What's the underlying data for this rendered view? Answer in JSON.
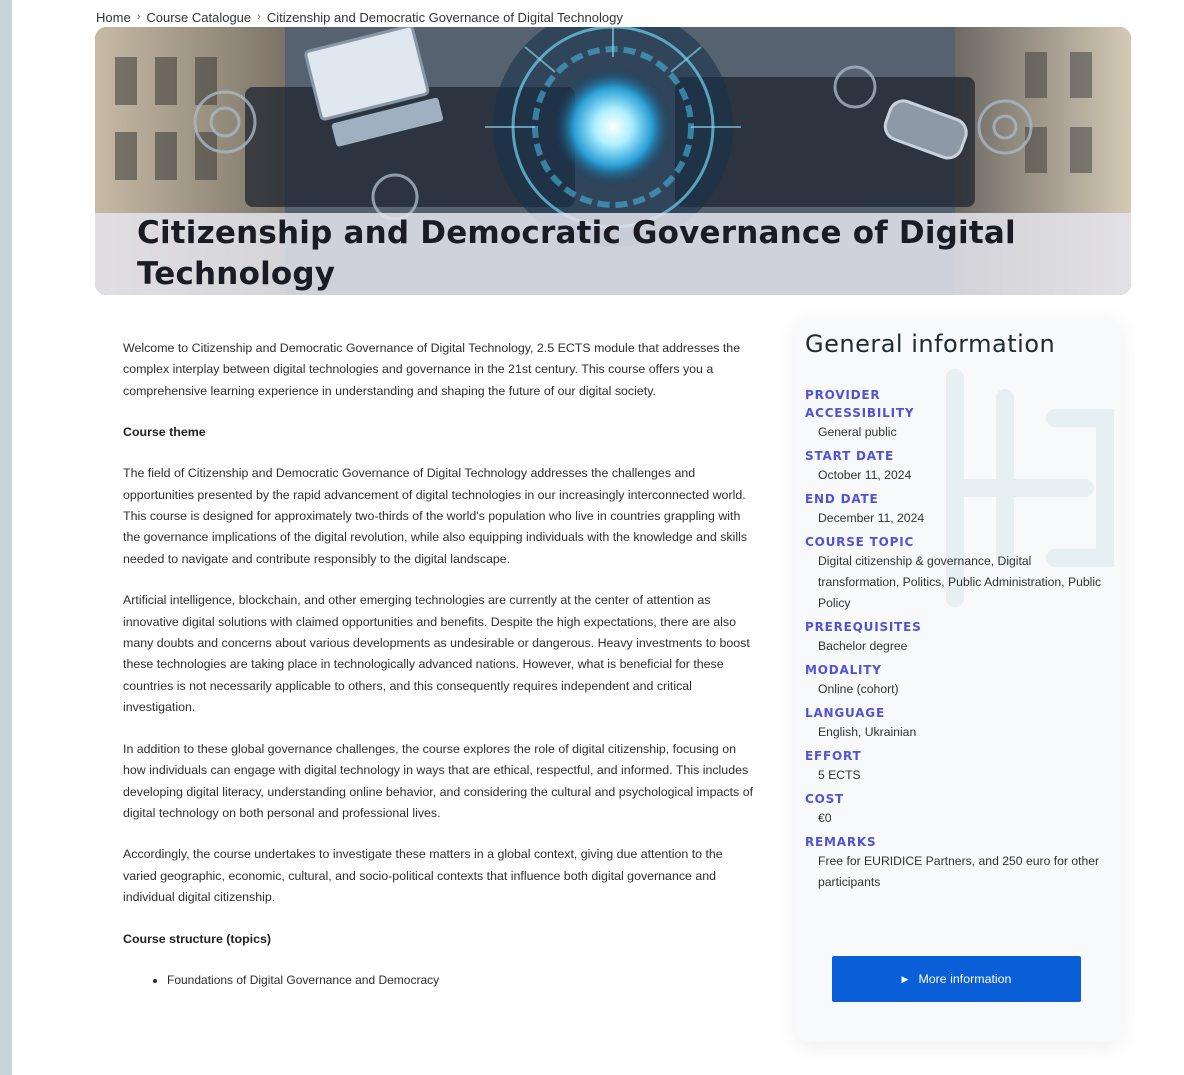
{
  "breadcrumb": {
    "home": "Home",
    "catalogue": "Course Catalogue",
    "current": "Citizenship and Democratic Governance of Digital Technology"
  },
  "hero": {
    "title": "Citizenship and Democratic Governance of Digital Technology"
  },
  "content": {
    "intro": "Welcome to Citizenship and Democratic Governance of Digital Technology, 2.5 ECTS module that addresses the complex interplay between digital technologies and governance in the 21st century. This course offers you a comprehensive learning experience in understanding and shaping the future of our digital society.",
    "theme_heading": "Course theme",
    "theme_p1": "The field of Citizenship and Democratic Governance of Digital Technology addresses the challenges and opportunities presented by the rapid advancement of digital technologies in our increasingly interconnected world. This course is designed for approximately two-thirds of the world's population who live in countries grappling with the governance implications of the digital revolution, while also equipping individuals with the knowledge and skills needed to navigate and contribute responsibly to the digital landscape.",
    "theme_p2": "Artificial intelligence, blockchain, and other emerging technologies are currently at the center of attention as innovative digital solutions with claimed opportunities and benefits. Despite the high expectations, there are also many doubts and concerns about various developments as undesirable or dangerous. Heavy investments to boost these technologies are taking place in technologically advanced nations. However, what is beneficial for these countries is not necessarily applicable to others, and this consequently requires independent and critical investigation.",
    "theme_p3": "In addition to these global governance challenges, the course explores the role of digital citizenship, focusing on how individuals can engage with digital technology in ways that are ethical, respectful, and informed. This includes developing digital literacy, understanding online behavior, and considering the cultural and psychological impacts of digital technology on both personal and professional lives.",
    "theme_p4": "Accordingly, the course undertakes to investigate these matters in a global context, giving due attention to the varied geographic, economic, cultural, and socio-political contexts that influence both digital governance and individual digital citizenship.",
    "structure_heading": "Course structure (topics)",
    "topics": [
      "Foundations of Digital Governance and Democracy"
    ]
  },
  "info": {
    "title": "General information",
    "provider_label": "Provider",
    "provider_value": "",
    "accessibility_label": "Accessibility",
    "accessibility_value": "General public",
    "start_label": "Start date",
    "start_value": "October 11, 2024",
    "end_label": "End date",
    "end_value": "December 11, 2024",
    "topic_label": "Course topic",
    "topic_value": "Digital citizenship & governance, Digital transformation, Politics, Public Administration, Public Policy",
    "prereq_label": "Prerequisites",
    "prereq_value": "Bachelor degree",
    "modality_label": "Modality",
    "modality_value": "Online (cohort)",
    "language_label": "Language",
    "language_value": "English, Ukrainian",
    "effort_label": "Effort",
    "effort_value": "5 ECTS",
    "cost_label": "Cost",
    "cost_value": "€0",
    "remarks_label": "Remarks",
    "remarks_value": "Free for EURIDICE Partners, and 250 euro for other participants",
    "button_label": "More information"
  },
  "colors": {
    "accent_label": "#5253d2",
    "button": "#0a5fd8",
    "top_accent": "#4cc3c9"
  }
}
